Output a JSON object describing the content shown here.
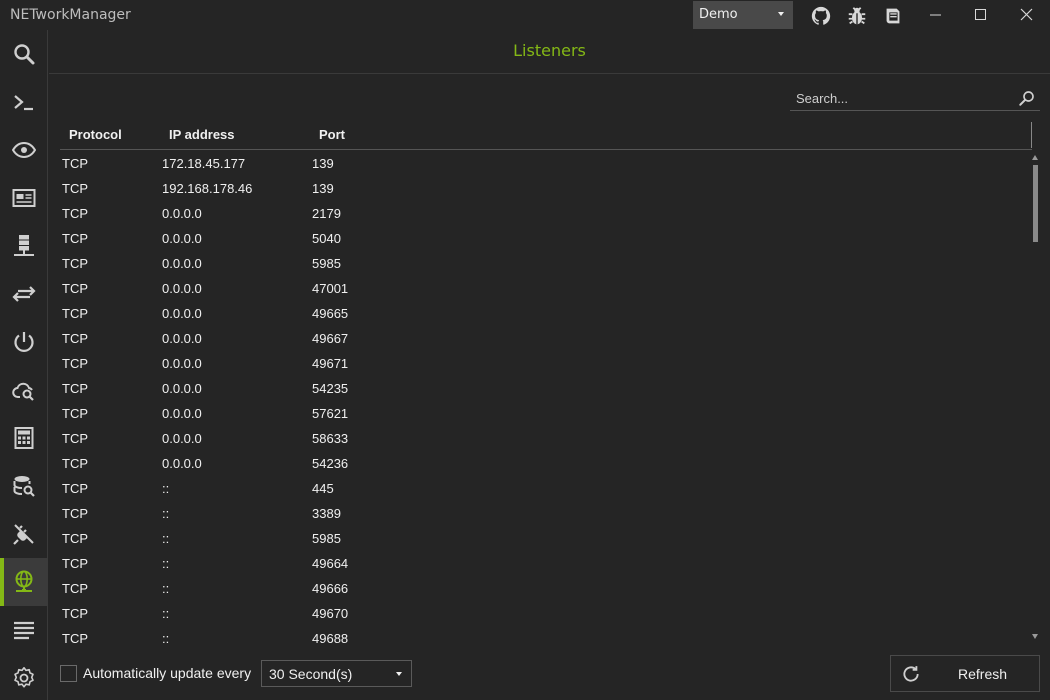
{
  "window": {
    "title": "NETworkManager",
    "profile": "Demo",
    "titlebar_icons": [
      "github-icon",
      "bug-icon",
      "book-icon"
    ],
    "controls": [
      "minimize-icon",
      "maximize-icon",
      "close-icon"
    ]
  },
  "sidebar": {
    "items": [
      {
        "name": "search-icon"
      },
      {
        "name": "terminal-icon"
      },
      {
        "name": "eye-icon"
      },
      {
        "name": "id-card-icon"
      },
      {
        "name": "server-icon"
      },
      {
        "name": "transfer-arrows-icon"
      },
      {
        "name": "power-icon"
      },
      {
        "name": "cloud-search-icon"
      },
      {
        "name": "calculator-icon"
      },
      {
        "name": "database-search-icon"
      },
      {
        "name": "plug-off-icon"
      },
      {
        "name": "globe-network-icon",
        "active": true
      },
      {
        "name": "list-icon"
      }
    ],
    "settings": "settings-gear-icon"
  },
  "page": {
    "title": "Listeners",
    "accent_color": "#84b816"
  },
  "search": {
    "placeholder": "Search..."
  },
  "table": {
    "headers": [
      "Protocol",
      "IP address",
      "Port"
    ],
    "rows": [
      [
        "TCP",
        "172.18.45.177",
        "139"
      ],
      [
        "TCP",
        "192.168.178.46",
        "139"
      ],
      [
        "TCP",
        "0.0.0.0",
        "2179"
      ],
      [
        "TCP",
        "0.0.0.0",
        "5040"
      ],
      [
        "TCP",
        "0.0.0.0",
        "5985"
      ],
      [
        "TCP",
        "0.0.0.0",
        "47001"
      ],
      [
        "TCP",
        "0.0.0.0",
        "49665"
      ],
      [
        "TCP",
        "0.0.0.0",
        "49667"
      ],
      [
        "TCP",
        "0.0.0.0",
        "49671"
      ],
      [
        "TCP",
        "0.0.0.0",
        "54235"
      ],
      [
        "TCP",
        "0.0.0.0",
        "57621"
      ],
      [
        "TCP",
        "0.0.0.0",
        "58633"
      ],
      [
        "TCP",
        "0.0.0.0",
        "54236"
      ],
      [
        "TCP",
        "::",
        "445"
      ],
      [
        "TCP",
        "::",
        "3389"
      ],
      [
        "TCP",
        "::",
        "5985"
      ],
      [
        "TCP",
        "::",
        "49664"
      ],
      [
        "TCP",
        "::",
        "49666"
      ],
      [
        "TCP",
        "::",
        "49670"
      ],
      [
        "TCP",
        "::",
        "49688"
      ]
    ]
  },
  "footer": {
    "auto_update_label": "Automatically update every",
    "auto_update_checked": false,
    "interval": "30 Second(s)",
    "refresh_label": "Refresh"
  }
}
